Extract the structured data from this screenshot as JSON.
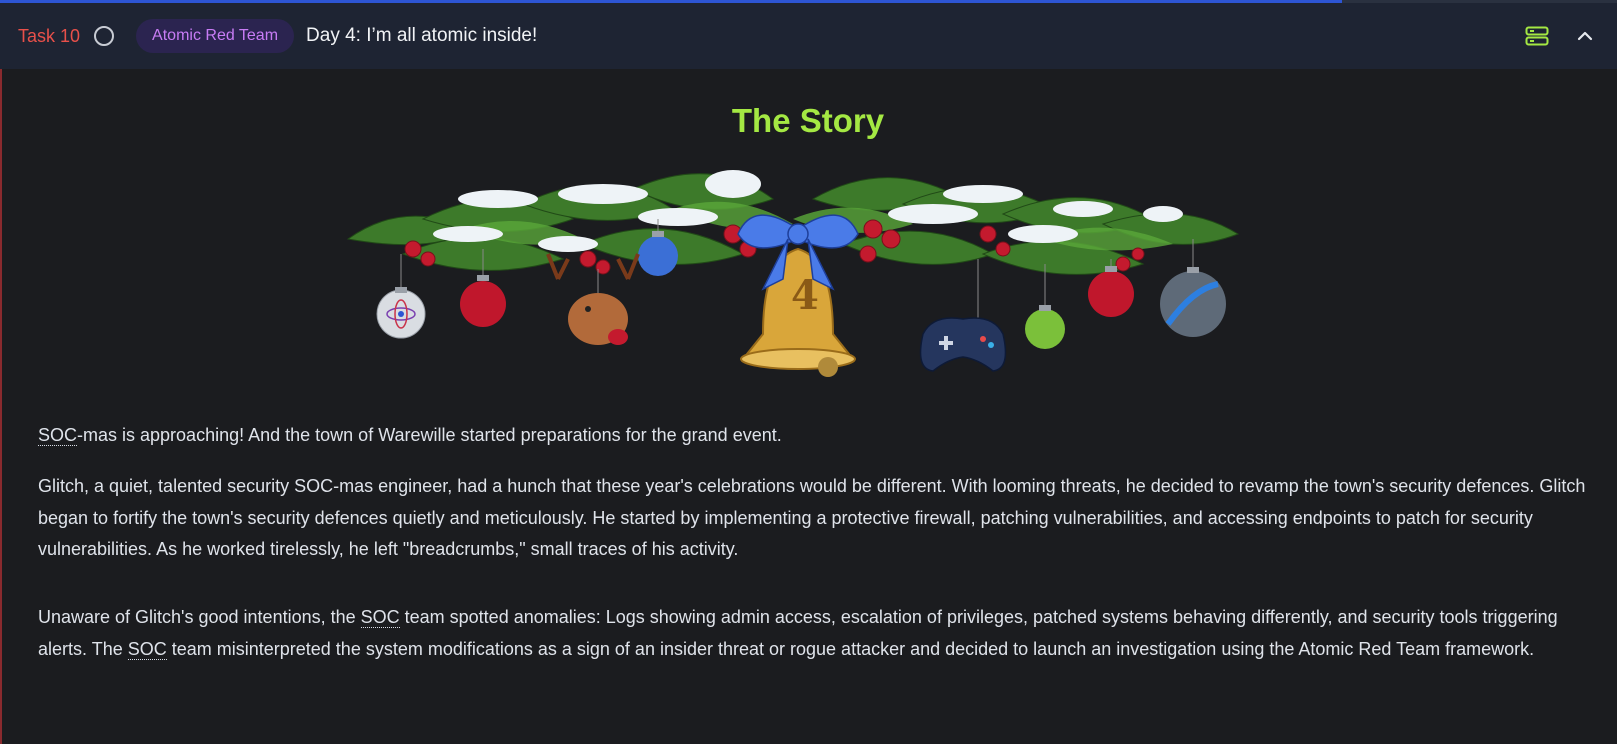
{
  "progress": {
    "fraction": 0.83
  },
  "header": {
    "task_label": "Task 10",
    "tag": "Atomic Red Team",
    "title": "Day 4: I’m all atomic inside!"
  },
  "icons": {
    "status": "circle-outline-icon",
    "server": "server-icon",
    "collapse": "chevron-up-icon"
  },
  "colors": {
    "task": "#e8504a",
    "tag_text": "#c87cf5",
    "story_title": "#a4e843",
    "server_icon": "#a4e843"
  },
  "story": {
    "title": "The Story",
    "p1_abbr": "SOC",
    "p1_rest": "-mas is approaching! And the town of Warewille started preparations for the grand event.",
    "p2": "Glitch, a quiet, talented security SOC-mas engineer, had a hunch that these year's celebrations would be different. With looming threats, he decided to revamp the town's security defences. Glitch began to fortify the town's security defences quietly and meticulously. He started by implementing a protective firewall, patching vulnerabilities, and accessing endpoints to patch for security vulnerabilities. As he worked tirelessly, he left \"breadcrumbs,\" small traces of his activity.",
    "p3_a": "Unaware of Glitch's good intentions, the ",
    "p3_abbr1": "SOC",
    "p3_b": " team spotted anomalies: Logs showing admin access, escalation of privileges, patched systems behaving differently, and security tools triggering alerts. The ",
    "p3_abbr2": "SOC",
    "p3_c": " team misinterpreted the system modifications as a sign of an insider threat or rogue attacker and decided to launch an investigation using the Atomic Red Team framework.",
    "bell_number": "4"
  }
}
